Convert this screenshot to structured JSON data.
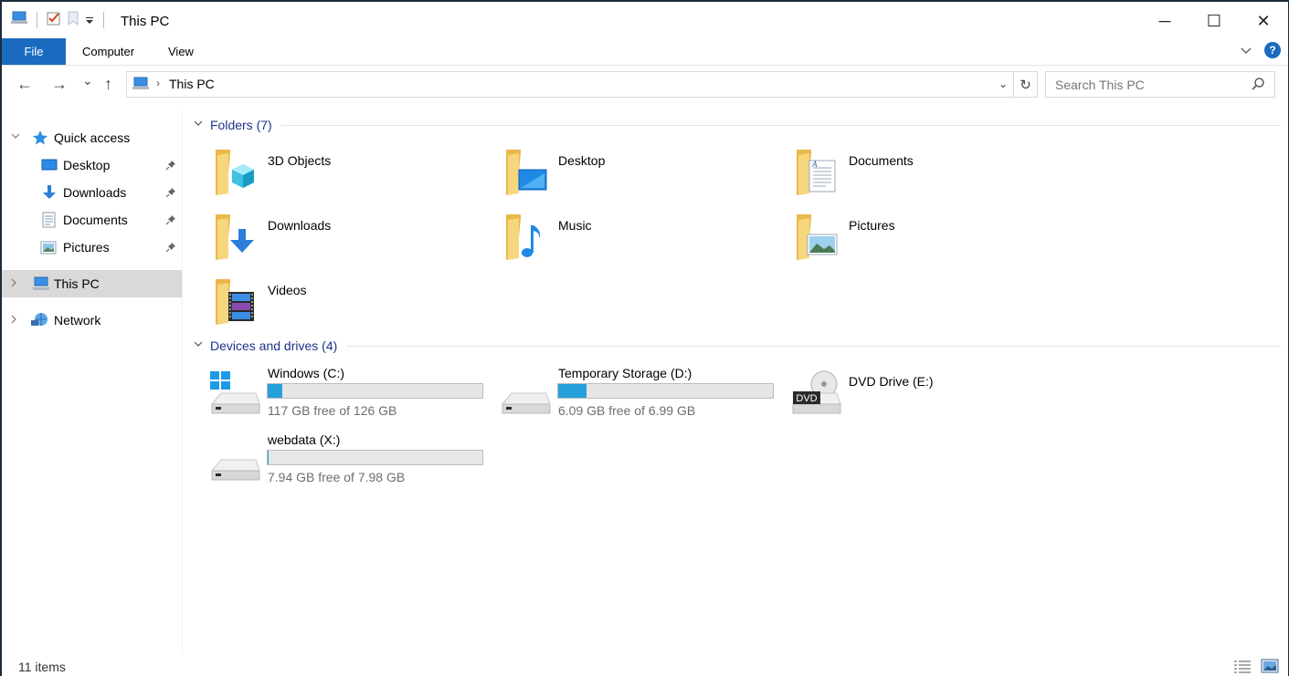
{
  "window": {
    "title": "This PC",
    "controls": {
      "minimize": "─",
      "maximize": "☐",
      "close": "✕"
    }
  },
  "ribbon": {
    "tabs": [
      {
        "label": "File",
        "active": true
      },
      {
        "label": "Computer",
        "active": false
      },
      {
        "label": "View",
        "active": false
      }
    ],
    "help_label": "?"
  },
  "navigation": {
    "back": "←",
    "forward": "→",
    "recent": "⌄",
    "up": "↑",
    "address": {
      "chevron": "›",
      "path": "This PC",
      "dropdown": "⌄",
      "refresh": "↻"
    },
    "search": {
      "placeholder": "Search This PC"
    }
  },
  "sidebar": {
    "items": [
      {
        "label": "Quick access",
        "icon": "star-icon",
        "pinned": false
      },
      {
        "label": "Desktop",
        "icon": "desktop-icon",
        "pinned": true
      },
      {
        "label": "Downloads",
        "icon": "download-icon",
        "pinned": true
      },
      {
        "label": "Documents",
        "icon": "document-icon",
        "pinned": true
      },
      {
        "label": "Pictures",
        "icon": "pictures-icon",
        "pinned": true
      },
      {
        "label": "This PC",
        "icon": "pc-icon",
        "selected": true
      },
      {
        "label": "Network",
        "icon": "network-icon"
      }
    ]
  },
  "content": {
    "folders_header": "Folders (7)",
    "folders": [
      {
        "name": "3D Objects",
        "overlay": "cube-icon"
      },
      {
        "name": "Desktop",
        "overlay": "desktop-icon"
      },
      {
        "name": "Documents",
        "overlay": "document-icon"
      },
      {
        "name": "Downloads",
        "overlay": "download-icon"
      },
      {
        "name": "Music",
        "overlay": "music-icon"
      },
      {
        "name": "Pictures",
        "overlay": "pictures-icon"
      },
      {
        "name": "Videos",
        "overlay": "film-icon"
      }
    ],
    "drives_header": "Devices and drives (4)",
    "drives": [
      {
        "name": "Windows (C:)",
        "free_text": "117 GB free of 126 GB",
        "used_fraction": 0.07,
        "icon": "windows-drive-icon"
      },
      {
        "name": "Temporary Storage (D:)",
        "free_text": "6.09 GB free of 6.99 GB",
        "used_fraction": 0.13,
        "icon": "hard-drive-icon"
      },
      {
        "name": "DVD Drive (E:)",
        "icon": "dvd-drive-icon",
        "dvd_label": "DVD"
      },
      {
        "name": "webdata (X:)",
        "free_text": "7.94 GB free of 7.98 GB",
        "used_fraction": 0.005,
        "icon": "hard-drive-icon"
      }
    ]
  },
  "status": {
    "items_count": "11 items"
  },
  "colors": {
    "accent": "#1a6bbf",
    "bar_fill": "#26a0da",
    "group_header": "#1e3287",
    "folder": "#f3c867"
  }
}
